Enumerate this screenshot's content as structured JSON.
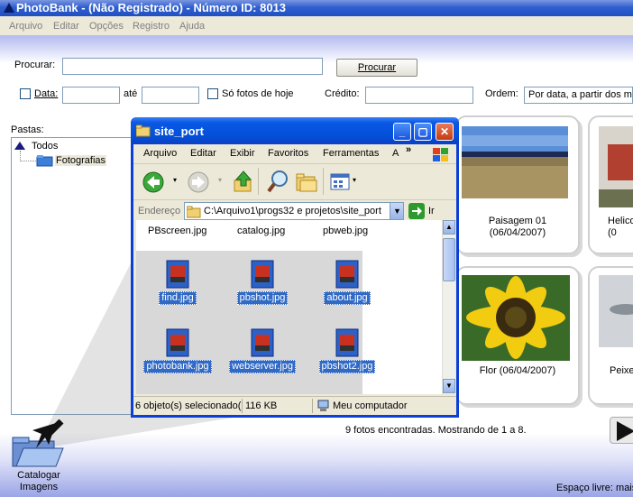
{
  "app": {
    "title": "PhotoBank - (Não Registrado) - Número ID: 8013",
    "menu": [
      "Arquivo",
      "Editar",
      "Opções",
      "Registro",
      "Ajuda"
    ]
  },
  "search": {
    "label": "Procurar:",
    "value": "",
    "button": "Procurar",
    "date_label": "Data:",
    "until_label": "até",
    "today_label": "Só fotos de hoje",
    "credit_label": "Crédito:",
    "order_label": "Ordem:",
    "order_value": "Por data, a partir dos ma"
  },
  "folders": {
    "label": "Pastas:",
    "root": "Todos",
    "child": "Fotografias"
  },
  "photos": [
    {
      "caption": "Paisagem 01\n(06/04/2007)"
    },
    {
      "caption": "Helico\n(0"
    },
    {
      "caption": "Flor (06/04/2007)"
    },
    {
      "caption": "Peixe"
    }
  ],
  "status": {
    "found": "9 fotos encontradas. Mostrando de 1 a 8.",
    "free_space": "Espaço livre: mais",
    "catalog_button": "Catalogar\nImagens"
  },
  "explorer": {
    "title": "site_port",
    "menu": [
      "Arquivo",
      "Editar",
      "Exibir",
      "Favoritos",
      "Ferramentas",
      "A"
    ],
    "address_label": "Endereço",
    "address_value": "C:\\Arquivo1\\progs32 e projetos\\site_port",
    "go_label": "Ir",
    "top_files": [
      "PBscreen.jpg",
      "catalog.jpg",
      "pbweb.jpg"
    ],
    "files": [
      "find.jpg",
      "pbshot.jpg",
      "about.jpg",
      "photobank.jpg",
      "webserver.jpg",
      "pbshot2.jpg"
    ],
    "status_selected": "6 objeto(s) selecionado(",
    "status_size": "116 KB",
    "status_location": "Meu computador"
  },
  "colors": {
    "xp_blue": "#0450d8",
    "selection": "#316ac5",
    "close_red": "#c43a12"
  }
}
